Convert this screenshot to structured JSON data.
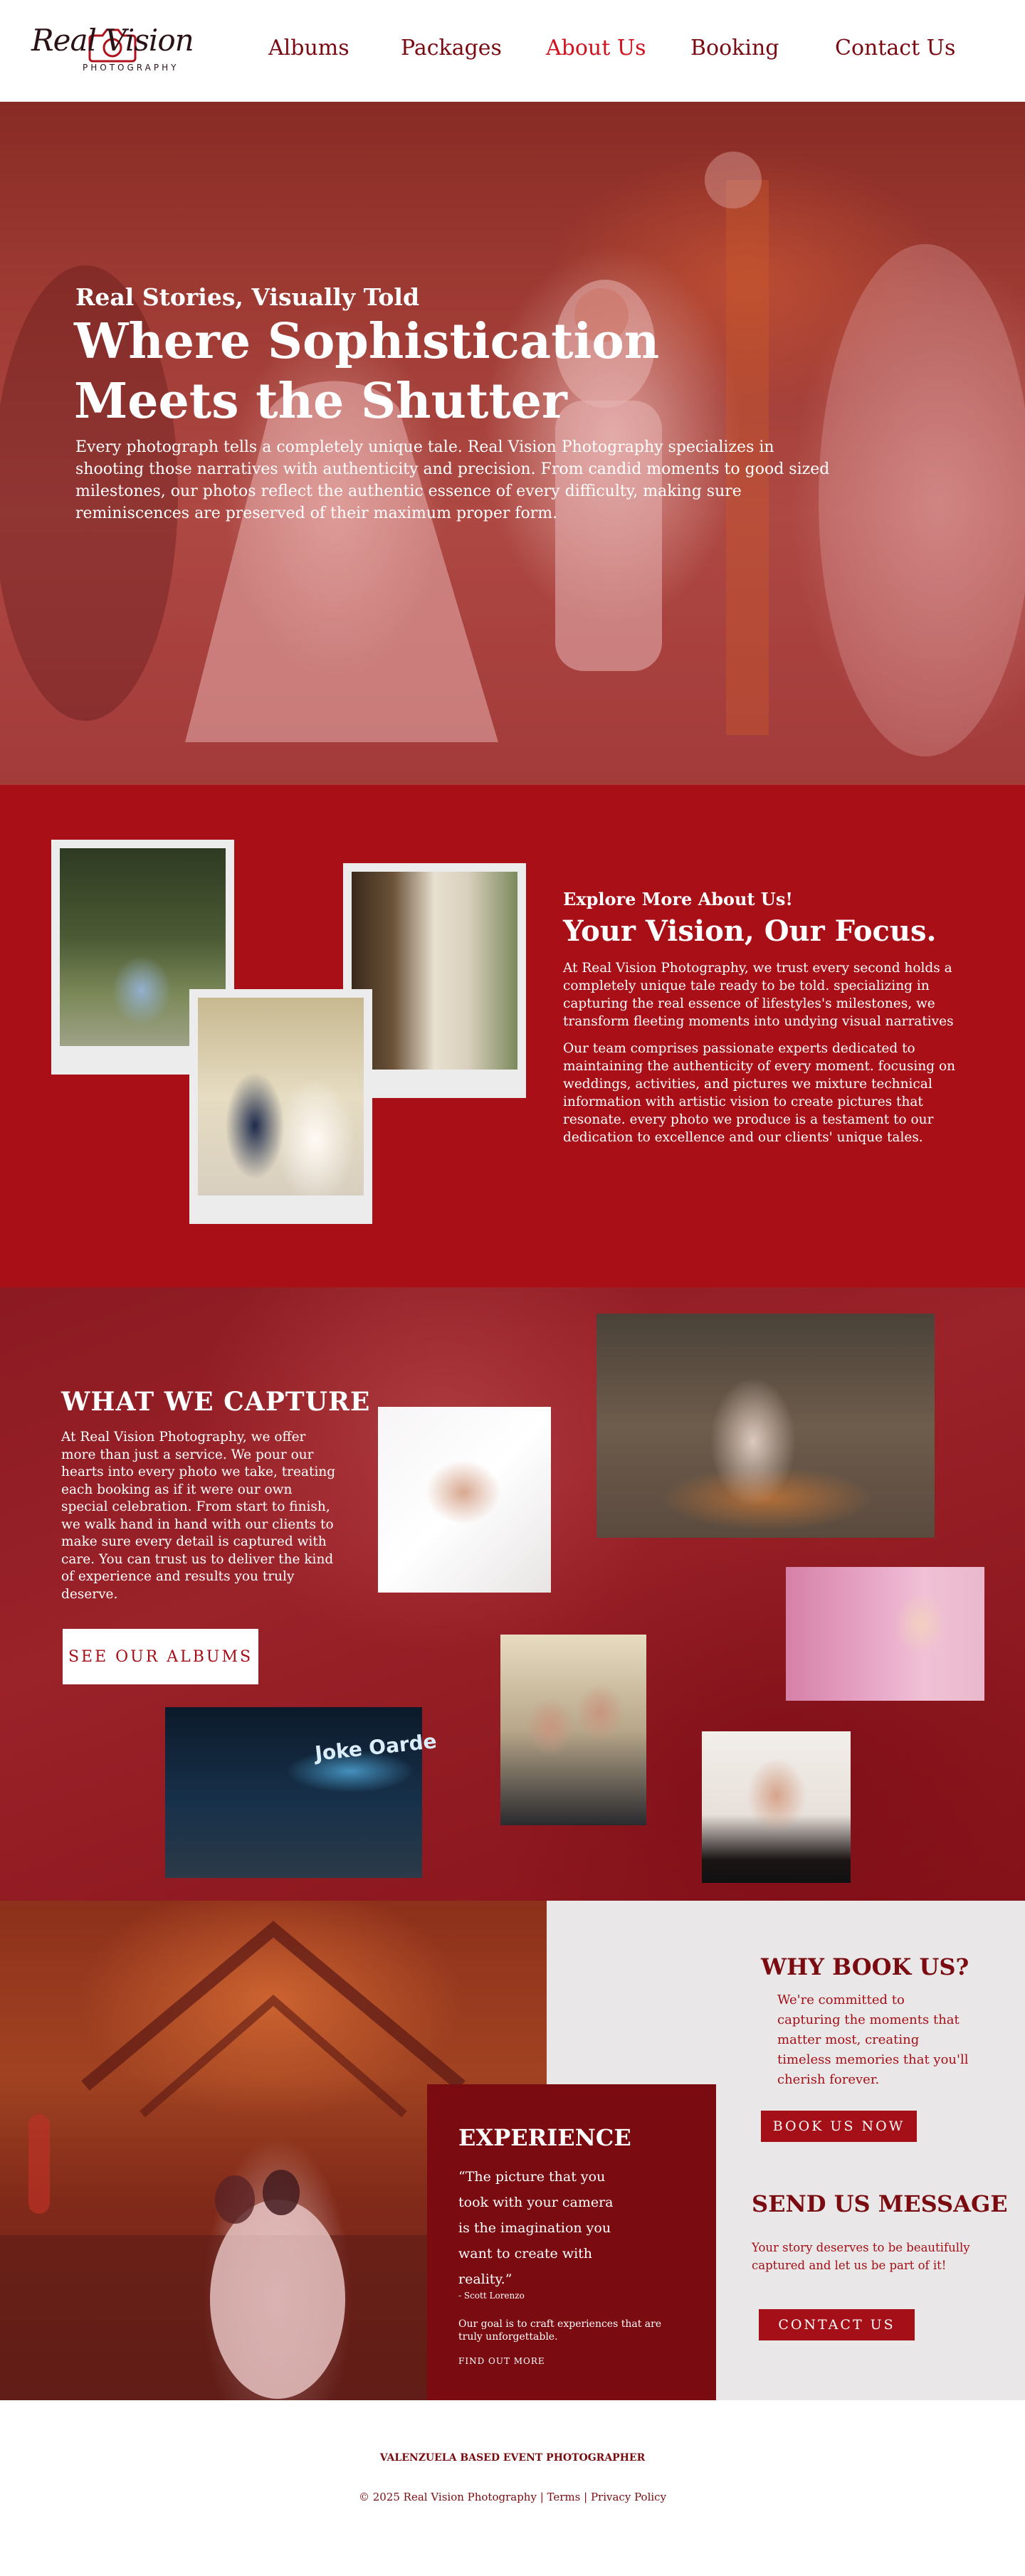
{
  "brand": {
    "logo_script": "Real Vision",
    "logo_sub": "PHOTOGRAPHY"
  },
  "nav": {
    "items": [
      {
        "label": "Albums"
      },
      {
        "label": "Packages"
      },
      {
        "label": "About Us",
        "active": true
      },
      {
        "label": "Booking"
      },
      {
        "label": "Contact Us"
      }
    ]
  },
  "hero": {
    "kicker": "Real Stories, Visually Told",
    "title": "Where Sophistication Meets the Shutter",
    "body": "Every photograph tells a completely unique tale. Real Vision Photography specializes in shooting those narratives with authenticity and precision. From candid moments to good sized milestones, our photos reflect the authentic essence of every difficulty, making sure reminiscences are preserved of their maximum proper form."
  },
  "about": {
    "kicker": "Explore More  About Us!",
    "title": "Your Vision, Our Focus.",
    "p1": "At Real Vision Photography, we trust every second holds a completely unique tale ready to be told. specializing in capturing the real essence of lifestyles's milestones, we transform fleeting moments into undying visual narratives",
    "p2": "Our team comprises passionate experts dedicated to maintaining the authenticity of every moment. focusing on weddings, activities, and pictures we mixture technical information with artistic vision to create pictures that resonate. every photo we produce is a testament to our dedication to excellence and our clients' unique tales."
  },
  "capture": {
    "title": "WHAT WE CAPTURE",
    "body": "At Real Vision Photography, we offer more than just a service. We pour our hearts into every photo we take, treating each booking as if it were our own special celebration. From start to finish, we walk hand in hand with our clients to make sure every detail is captured with care. You can trust us to deliver the kind of experience and results you truly deserve.",
    "button": "SEE OUR ALBUMS",
    "stage_sign": "Joke Oarde"
  },
  "booking": {
    "experience": {
      "title": "EXPERIENCE",
      "quote": "“The picture that you took with your camera is the imagination you want to create with reality.”",
      "author": "- Scott Lorenzo",
      "goal": "Our goal is to craft experiences that are truly unforgettable.",
      "link": "FIND OUT MORE"
    },
    "why": {
      "title": "WHY BOOK US?",
      "body": "We're committed to capturing the moments that matter most, creating timeless memories that you'll cherish forever.",
      "button": "BOOK US NOW"
    },
    "send": {
      "title": "SEND US MESSAGE",
      "body": "Your story deserves to be beautifully captured and let us be part of it!",
      "button": "CONTACT US"
    }
  },
  "footer": {
    "tagline": "VALENZUELA BASED EVENT PHOTOGRAPHER",
    "copyright": "© 2025 Real Vision Photography",
    "sep": " | ",
    "terms": "Terms",
    "privacy": "Privacy Policy"
  },
  "colors": {
    "primary_red": "#a80f16",
    "dark_red": "#7a0b10",
    "active_nav": "#d0121e"
  }
}
